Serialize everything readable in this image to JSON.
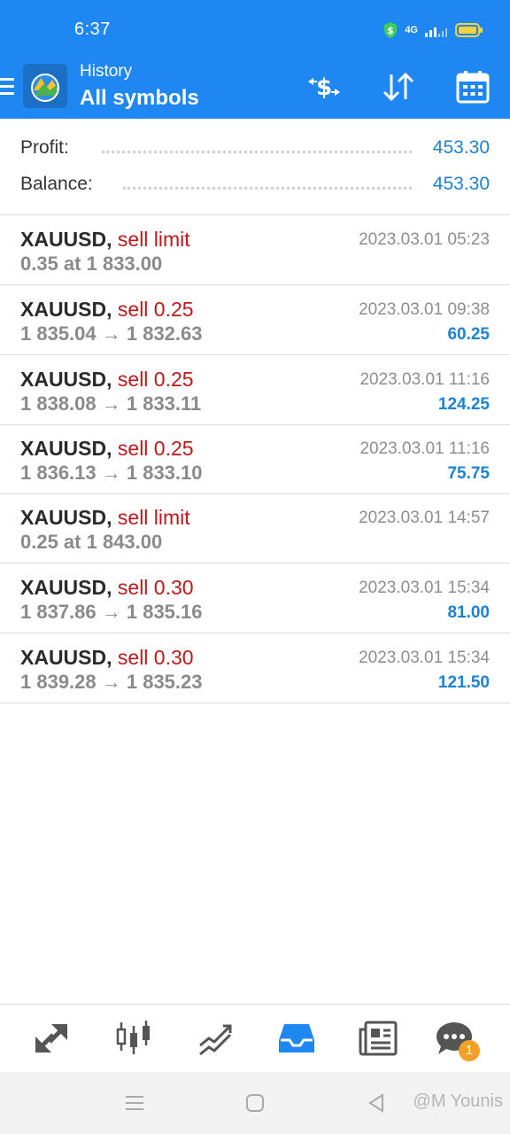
{
  "status_bar": {
    "time": "6:37",
    "network": "4G"
  },
  "header": {
    "subtitle": "History",
    "title": "All symbols"
  },
  "summary": [
    {
      "label": "Profit:",
      "value": "453.30"
    },
    {
      "label": "Balance:",
      "value": "453.30"
    }
  ],
  "deals": [
    {
      "symbol": "XAUUSD,",
      "type": "sell limit",
      "details": "0.35 at 1 833.00",
      "time": "2023.03.01 05:23",
      "profit": ""
    },
    {
      "symbol": "XAUUSD,",
      "type": "sell 0.25",
      "details": "1 835.04 → 1 832.63",
      "time": "2023.03.01 09:38",
      "profit": "60.25"
    },
    {
      "symbol": "XAUUSD,",
      "type": "sell 0.25",
      "details": "1 838.08 → 1 833.11",
      "time": "2023.03.01 11:16",
      "profit": "124.25"
    },
    {
      "symbol": "XAUUSD,",
      "type": "sell 0.25",
      "details": "1 836.13 → 1 833.10",
      "time": "2023.03.01 11:16",
      "profit": "75.75"
    },
    {
      "symbol": "XAUUSD,",
      "type": "sell limit",
      "details": "0.25 at 1 843.00",
      "time": "2023.03.01 14:57",
      "profit": ""
    },
    {
      "symbol": "XAUUSD,",
      "type": "sell 0.30",
      "details": "1 837.86 → 1 835.16",
      "time": "2023.03.01 15:34",
      "profit": "81.00"
    },
    {
      "symbol": "XAUUSD,",
      "type": "sell 0.30",
      "details": "1 839.28 → 1 835.23",
      "time": "2023.03.01 15:34",
      "profit": "121.50"
    }
  ],
  "tabs": [
    {
      "icon": "quotes-arrows-icon",
      "active": false
    },
    {
      "icon": "candlestick-chart-icon",
      "active": false
    },
    {
      "icon": "trade-chart-icon",
      "active": false
    },
    {
      "icon": "history-inbox-icon",
      "active": true
    },
    {
      "icon": "news-icon",
      "active": false
    },
    {
      "icon": "chat-icon",
      "active": false,
      "badge": "1"
    }
  ],
  "watermark": "@M Younis",
  "colors": {
    "header_bg": "#1f87f2",
    "sell": "#c0171b",
    "profit": "#1e82d2",
    "tab_active": "#1f87f2",
    "tab_inactive": "#555555",
    "badge": "#f2a128"
  }
}
